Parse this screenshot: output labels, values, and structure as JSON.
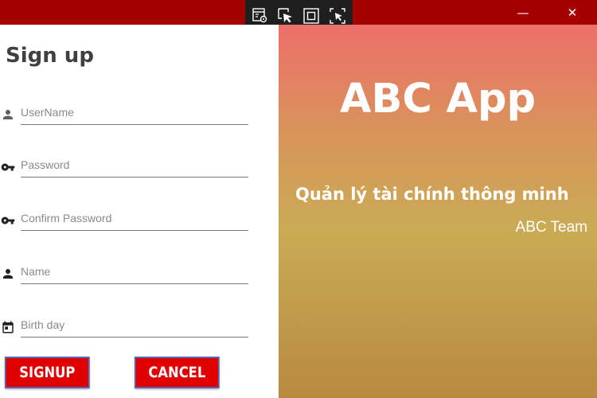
{
  "window": {
    "minimize_glyph": "—",
    "close_glyph": "✕"
  },
  "devtools_toolbar": {
    "icons": [
      "live-visual-tree-icon",
      "select-element-icon",
      "display-layout-adorners-icon",
      "track-focus-icon"
    ]
  },
  "signup": {
    "title": "Sign up",
    "fields": [
      {
        "icon": "person-icon",
        "placeholder": "UserName"
      },
      {
        "icon": "key-icon",
        "placeholder": "Password"
      },
      {
        "icon": "key-icon",
        "placeholder": "Confirm Password"
      },
      {
        "icon": "person-icon",
        "placeholder": "Name"
      },
      {
        "icon": "calendar-icon",
        "placeholder": "Birth day"
      }
    ],
    "signup_label": "SIGNUP",
    "cancel_label": "CANCEL"
  },
  "brand": {
    "app_name": "ABC App",
    "slogan": "Quản lý tài chính thông minh",
    "team": "ABC Team"
  },
  "colors": {
    "title_bar": "#a50000",
    "button_red": "#e00000",
    "gradient_top": "#ee6e6a",
    "gradient_bottom": "#b88a40"
  }
}
